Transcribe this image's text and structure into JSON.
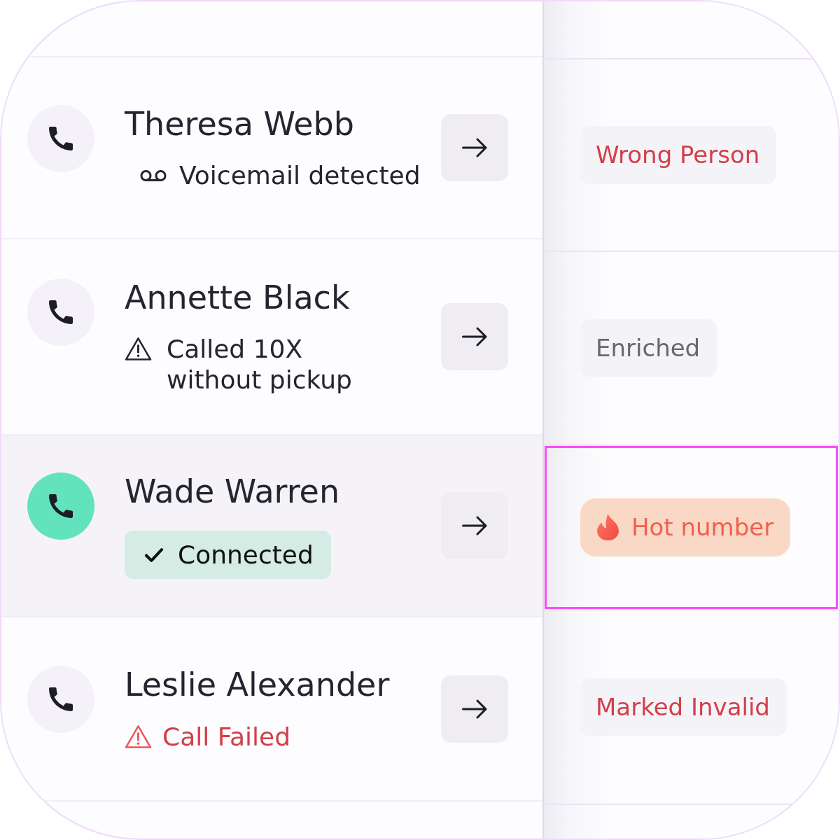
{
  "calls": [
    {
      "name": "Theresa Webb",
      "selected": false,
      "status": {
        "kind": "voicemail",
        "text": "Voicemail detected"
      }
    },
    {
      "name": "Annette Black",
      "selected": false,
      "status": {
        "kind": "warning",
        "text": "Called 10X without pickup"
      }
    },
    {
      "name": "Wade Warren",
      "selected": true,
      "status": {
        "kind": "connected",
        "text": "Connected"
      }
    },
    {
      "name": "Leslie Alexander",
      "selected": false,
      "status": {
        "kind": "failed",
        "text": "Call Failed"
      }
    }
  ],
  "tags": [
    {
      "text": "Wrong Person",
      "kind": "negative",
      "selected": false
    },
    {
      "text": "Enriched",
      "kind": "neutral",
      "selected": false
    },
    {
      "text": "Hot number",
      "kind": "hot",
      "selected": true
    },
    {
      "text": "Marked Invalid",
      "kind": "negative",
      "selected": false
    }
  ]
}
